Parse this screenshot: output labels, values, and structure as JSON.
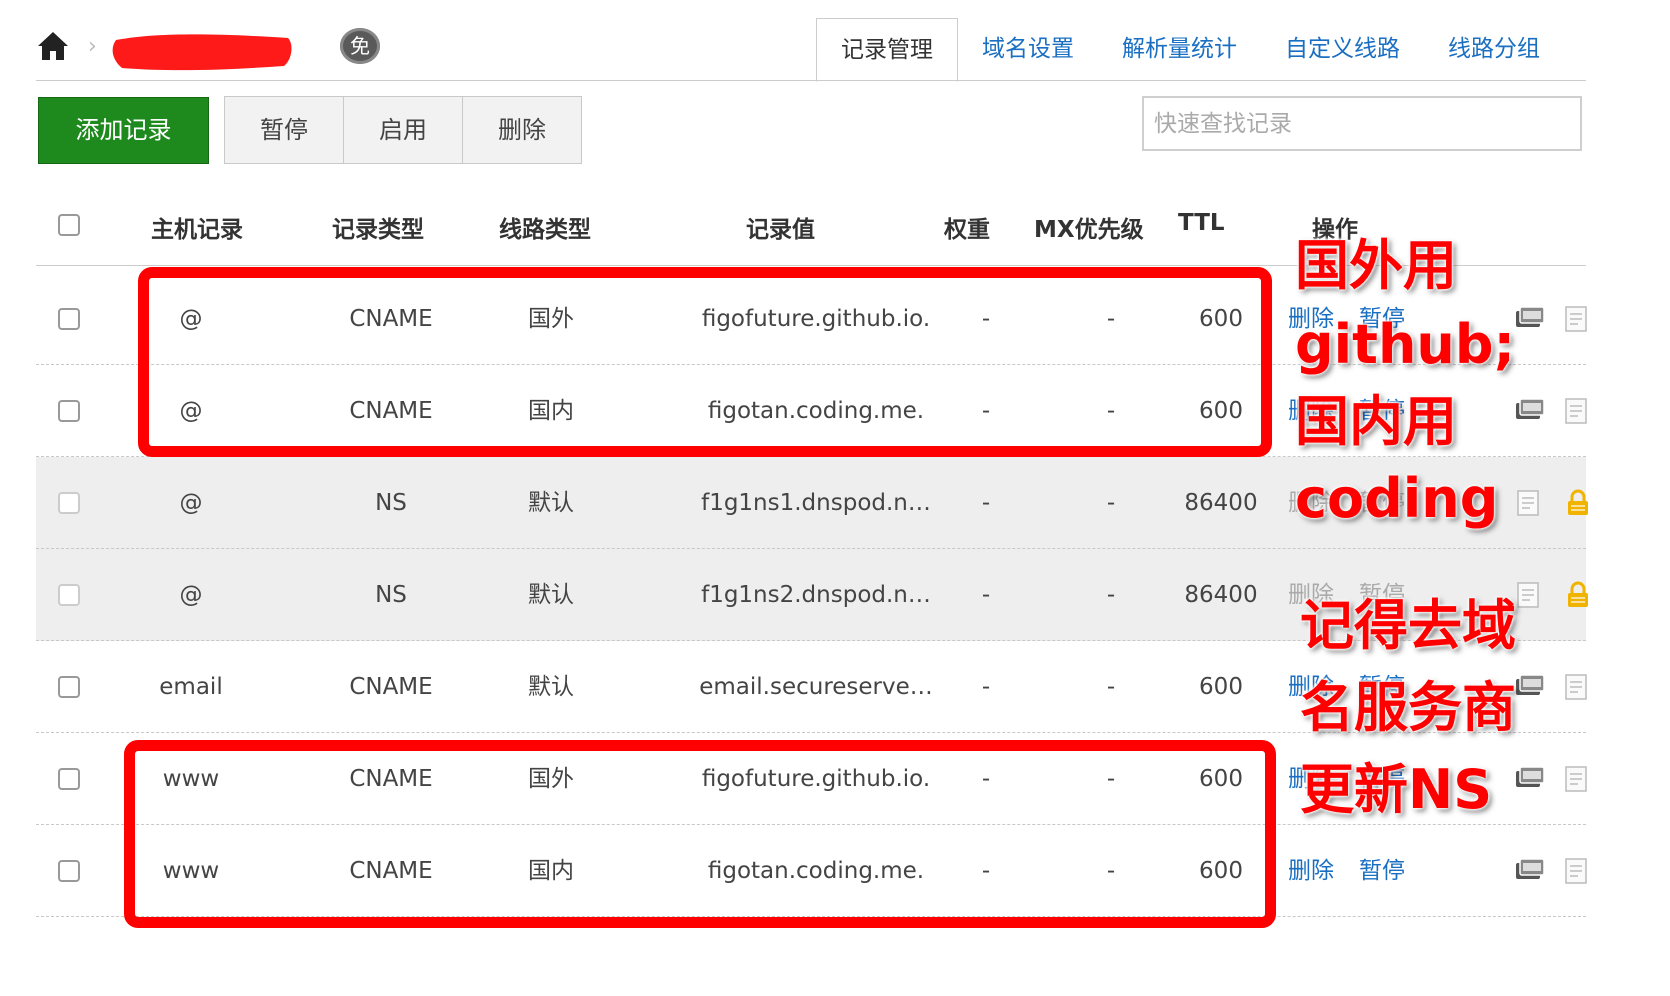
{
  "header": {
    "breadcrumb_sep": "›",
    "free_badge": "免",
    "tabs": [
      "记录管理",
      "域名设置",
      "解析量统计",
      "自定义线路",
      "线路分组"
    ],
    "active_tab": 0
  },
  "toolbar": {
    "add_label": "添加记录",
    "pause_label": "暂停",
    "enable_label": "启用",
    "delete_label": "删除",
    "search_placeholder": "快速查找记录"
  },
  "table": {
    "columns": {
      "host": "主机记录",
      "type": "记录类型",
      "line": "线路类型",
      "value": "记录值",
      "weight": "权重",
      "mx": "MX优先级",
      "ttl": "TTL",
      "ops": "操作"
    },
    "rows": [
      {
        "host": "@",
        "type": "CNAME",
        "line": "国外",
        "value": "figofuture.github.io.",
        "weight": "-",
        "mx": "-",
        "ttl": "600",
        "op_delete": "删除",
        "op_pause": "暂停"
      },
      {
        "host": "@",
        "type": "CNAME",
        "line": "国内",
        "value": "figotan.coding.me.",
        "weight": "-",
        "mx": "-",
        "ttl": "600",
        "op_delete": "删除",
        "op_pause": "暂停"
      },
      {
        "host": "@",
        "type": "NS",
        "line": "默认",
        "value": "f1g1ns1.dnspod.n…",
        "weight": "-",
        "mx": "-",
        "ttl": "86400",
        "op_delete": "删除",
        "op_pause": "暂停"
      },
      {
        "host": "@",
        "type": "NS",
        "line": "默认",
        "value": "f1g1ns2.dnspod.n…",
        "weight": "-",
        "mx": "-",
        "ttl": "86400",
        "op_delete": "删除",
        "op_pause": "暂停"
      },
      {
        "host": "email",
        "type": "CNAME",
        "line": "默认",
        "value": "email.secureserve…",
        "weight": "-",
        "mx": "-",
        "ttl": "600",
        "op_delete": "删除",
        "op_pause": "暂停"
      },
      {
        "host": "www",
        "type": "CNAME",
        "line": "国外",
        "value": "figofuture.github.io.",
        "weight": "-",
        "mx": "-",
        "ttl": "600",
        "op_delete": "删除",
        "op_pause": "暂停"
      },
      {
        "host": "www",
        "type": "CNAME",
        "line": "国内",
        "value": "figotan.coding.me.",
        "weight": "-",
        "mx": "-",
        "ttl": "600",
        "op_delete": "删除",
        "op_pause": "暂停"
      }
    ]
  },
  "annotations": {
    "note1": [
      "国外用",
      "github;",
      "国内用",
      "coding"
    ],
    "note2": [
      "记得去域",
      "名服务商",
      "更新NS"
    ],
    "color": "#ff0000"
  },
  "colors": {
    "primary_button": "#1e8a1e",
    "link": "#1a6fc2",
    "ns_row_bg": "#eeeeee",
    "lock": "#f0b400"
  }
}
